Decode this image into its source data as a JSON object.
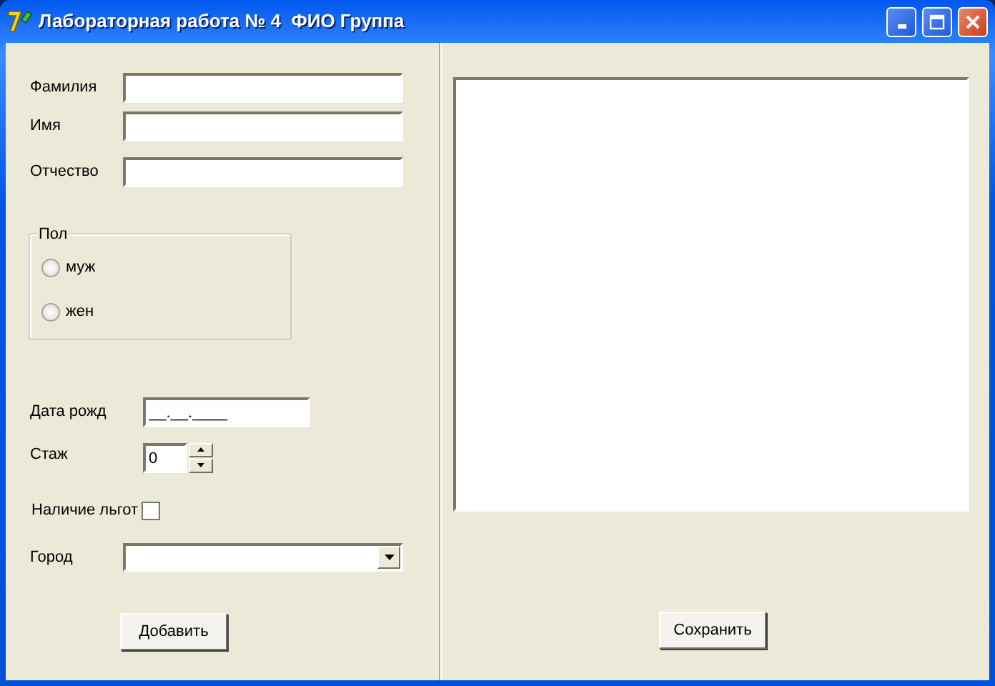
{
  "window": {
    "title": "Лабораторная работа № 4  ФИО Группа"
  },
  "name_fields": [
    {
      "label": "Фамилия"
    },
    {
      "label": "Имя"
    },
    {
      "label": "Отчество"
    }
  ],
  "gender": {
    "title": "Пол",
    "options": [
      {
        "label": "муж",
        "selected": false
      },
      {
        "label": "жен",
        "selected": false
      }
    ]
  },
  "birth_date": {
    "label": "Дата рожд",
    "value": "__.__.____"
  },
  "experience": {
    "label": "Стаж",
    "value": "0"
  },
  "benefits": {
    "label": "Наличие льгот",
    "checked": false
  },
  "city": {
    "label": "Город"
  },
  "add_button": "Добавить",
  "save_button": "Сохранить"
}
